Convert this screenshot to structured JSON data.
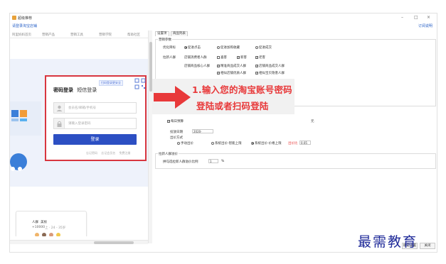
{
  "window": {
    "title": "超级推荐",
    "controls": {
      "minimize": "–",
      "maximize": "□",
      "close": "×"
    }
  },
  "header": {
    "login_link": "请登录淘宝店铺",
    "help_link": "订阅说明"
  },
  "browser": {
    "nav_items": [
      "阿里妈妈首页",
      "营销产品",
      "营销工具",
      "营销学院",
      "帮助社区"
    ],
    "login_card": {
      "qr_tip": "扫码登录更安全",
      "tab_password": "密码登录",
      "tab_sms": "短信登录",
      "username_placeholder": "会员名/邮箱/手机号",
      "password_placeholder": "请输入登录密码",
      "login_button": "登录",
      "links": [
        "忘记密码",
        "忘记会员名",
        "免费注册"
      ]
    },
    "promo": {
      "label": "人群",
      "category": "美妆",
      "count": "+10000",
      "range": "上 · 24 - 35岁"
    }
  },
  "settings": {
    "tabs": [
      "设置项",
      "商品列表"
    ],
    "active_tab": "设置项",
    "group_marketing": "营销参数",
    "optimize_label": "优化目标",
    "optimize_options": [
      "促进点击",
      "促进加购收藏",
      "促进成交"
    ],
    "optimize_selected": 0,
    "crowd_label": "拉新人群",
    "crowd_row1_label": "店铺消费者人群",
    "crowd_row1_opts": [
      {
        "label": "喜客",
        "checked": false
      },
      {
        "label": "新客",
        "checked": true
      },
      {
        "label": "老客",
        "checked": true
      }
    ],
    "crowd_row2_label": "店铺商品核心人群",
    "crowd_row2_opts": [
      {
        "label": "精准商品成交人群",
        "checked": true
      },
      {
        "label": "店铺商品成交人群",
        "checked": true
      }
    ],
    "crowd_row3_opts": [
      {
        "label": "相似店铺优质人群",
        "checked": true
      },
      {
        "label": "相似宝贝隐患人群",
        "checked": true
      }
    ],
    "daily_budget_label": "每日预算",
    "budget_suffix": "元",
    "invest_date_label": "投放日期",
    "date_value": "2020-",
    "bid_method_label": "出价方式",
    "bid_options": [
      "手动出价",
      "系统出价-智能上限",
      "系统出价-价格上限"
    ],
    "bid_selected": 2,
    "bid_ratio_label": "出价比",
    "bid_ratio_value": "0.05",
    "group_bid": "拉新人群溢价",
    "premium_label": "拼勾选拉新人群溢价比例",
    "premium_value": "1",
    "premium_unit": "%",
    "ok_button": "确定设置",
    "cancel_button": "关闭"
  },
  "annotation": {
    "line1": "1.输入您的淘宝账号密码",
    "line2": "登陆或者扫码登陆",
    "color": "#e8393a"
  },
  "watermark": "最需教育"
}
